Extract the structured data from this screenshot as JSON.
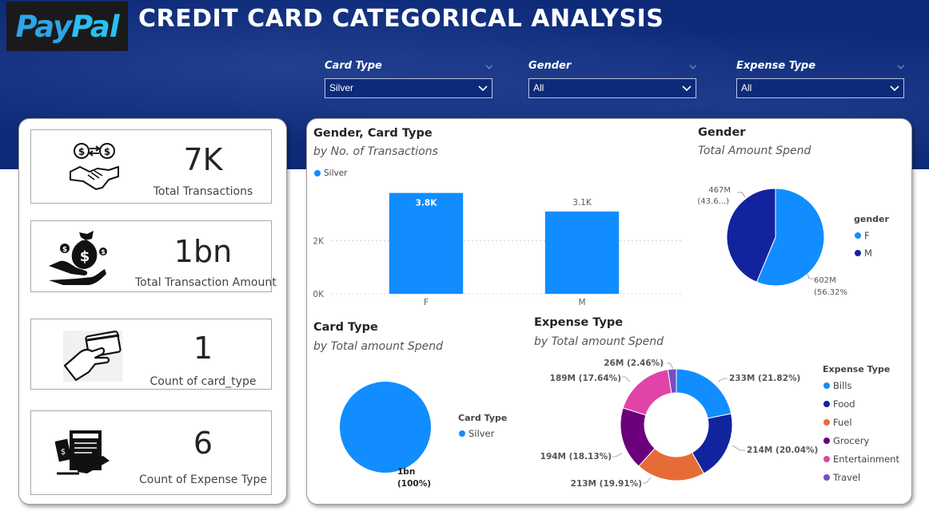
{
  "header": {
    "logo_text_1": "Pay",
    "logo_text_2": "Pal",
    "title": "CREDIT CARD CATEGORICAL ANALYSIS"
  },
  "filters": [
    {
      "label": "Card Type",
      "value": "Silver"
    },
    {
      "label": "Gender",
      "value": "All"
    },
    {
      "label": "Expense Type",
      "value": "All"
    }
  ],
  "kpis": [
    {
      "value": "7K",
      "label": "Total Transactions",
      "icon": "money-exchange-handshake-icon"
    },
    {
      "value": "1bn",
      "label": "Total Transaction Amount",
      "icon": "money-bag-hand-icon"
    },
    {
      "value": "1",
      "label": "Count of card_type",
      "icon": "hand-credit-card-icon"
    },
    {
      "value": "6",
      "label": "Count of Expense Type",
      "icon": "expenses-document-icon"
    }
  ],
  "colors": {
    "blue": "#118dff",
    "navy": "#12239e",
    "orange": "#e66c37",
    "purple": "#6b007b",
    "pink": "#e044a7",
    "violet": "#744ec2",
    "banner": "#0c2a78"
  },
  "chart_data": [
    {
      "type": "bar",
      "title": "Gender, Card Type",
      "subtitle": "by No. of Transactions",
      "categories": [
        "F",
        "M"
      ],
      "series": [
        {
          "name": "Silver",
          "values": [
            3800,
            3100
          ]
        }
      ],
      "data_labels": [
        "3.8K",
        "3.1K"
      ],
      "y_ticks": [
        "0K",
        "2K"
      ],
      "ylim": [
        0,
        4000
      ],
      "grid": true,
      "legend": "top-left"
    },
    {
      "type": "pie",
      "title": "Gender",
      "subtitle": "Total Amount Spend",
      "legend_title": "gender",
      "legend": "right",
      "slices": [
        {
          "label": "F",
          "value": 602,
          "value_label": "602M",
          "pct_label": "(56.32%)",
          "color": "#118dff"
        },
        {
          "label": "M",
          "value": 467,
          "value_label": "467M",
          "pct_label": "(43.6...)",
          "color": "#12239e"
        }
      ]
    },
    {
      "type": "pie",
      "title": "Card Type",
      "subtitle": "by Total amount Spend",
      "legend_title": "Card Type",
      "legend": "right",
      "slices": [
        {
          "label": "Silver",
          "value": 1000,
          "value_label": "1bn",
          "pct_label": "(100%)",
          "color": "#118dff"
        }
      ]
    },
    {
      "type": "donut",
      "title": "Expense Type",
      "subtitle": "by Total amount Spend",
      "legend_title": "Expense Type",
      "legend": "right",
      "slices": [
        {
          "label": "Bills",
          "value": 233,
          "data_label": "233M (21.82%)",
          "color": "#118dff"
        },
        {
          "label": "Food",
          "value": 214,
          "data_label": "214M (20.04%)",
          "color": "#12239e"
        },
        {
          "label": "Fuel",
          "value": 213,
          "data_label": "213M (19.91%)",
          "color": "#e66c37"
        },
        {
          "label": "Grocery",
          "value": 194,
          "data_label": "194M (18.13%)",
          "color": "#6b007b"
        },
        {
          "label": "Entertainment",
          "value": 189,
          "data_label": "189M (17.64%)",
          "color": "#e044a7"
        },
        {
          "label": "Travel",
          "value": 26,
          "data_label": "26M (2.46%)",
          "color": "#744ec2"
        }
      ]
    }
  ]
}
